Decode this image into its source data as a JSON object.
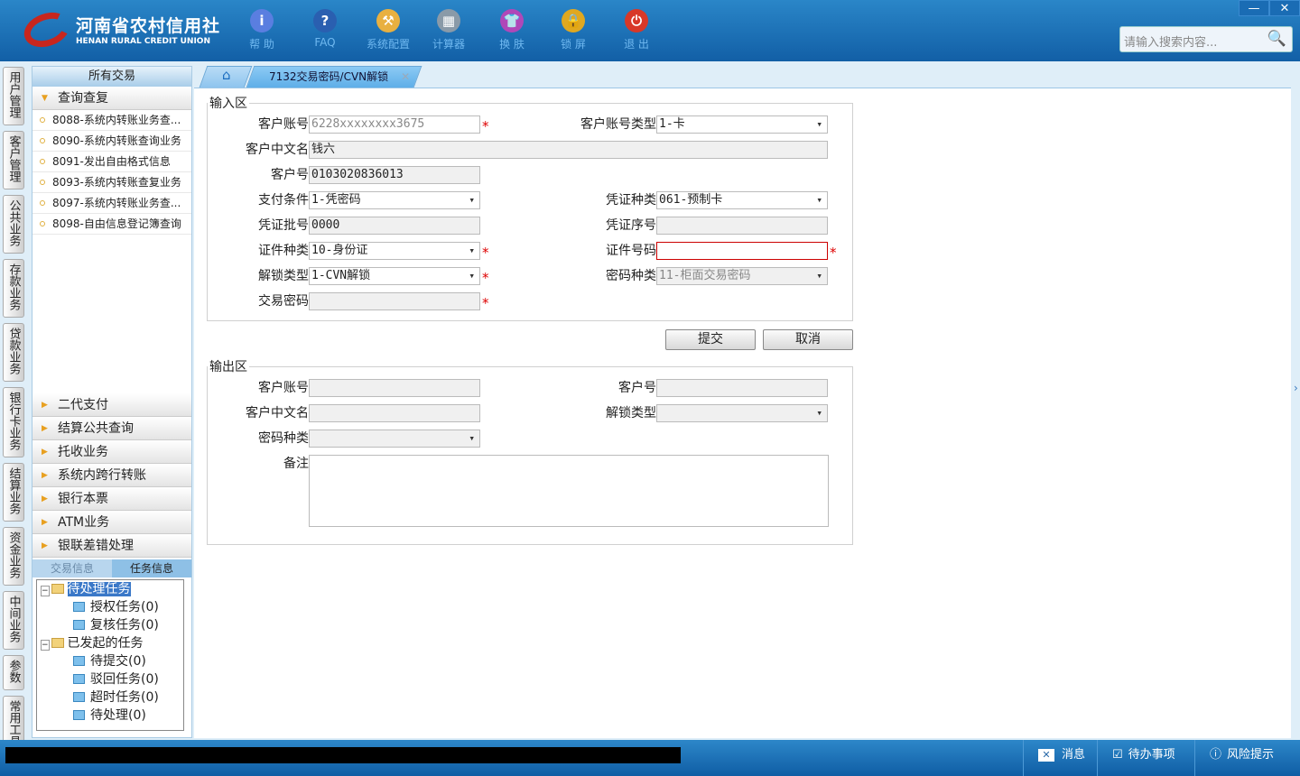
{
  "header": {
    "logo_cn": "河南省农村信用社",
    "logo_en": "HENAN RURAL CREDIT UNION",
    "tools": [
      {
        "label": "帮 助",
        "icon": "info-icon",
        "color": "#5a7ee0",
        "glyph": "i"
      },
      {
        "label": "FAQ",
        "icon": "help-icon",
        "color": "#2a5fb0",
        "glyph": "?"
      },
      {
        "label": "系统配置",
        "icon": "toolbox-icon",
        "color": "#e8b040",
        "glyph": "⚒"
      },
      {
        "label": "计算器",
        "icon": "calculator-icon",
        "color": "#8a9aa8",
        "glyph": "▦"
      },
      {
        "label": "换 肤",
        "icon": "shirt-icon",
        "color": "#b048b8",
        "glyph": "👕"
      },
      {
        "label": "锁 屏",
        "icon": "lock-icon",
        "color": "#e0a820",
        "glyph": "🔒"
      },
      {
        "label": "退 出",
        "icon": "power-icon",
        "color": "#d83828",
        "glyph": "⏻"
      }
    ],
    "minimize": "—",
    "close": "✕",
    "search_placeholder": "请输入搜索内容..."
  },
  "vtabs": [
    "用户管理",
    "客户管理",
    "公共业务",
    "存款业务",
    "贷款业务",
    "银行卡业务",
    "结算业务",
    "资金业务",
    "中间业务",
    "参数",
    "常用工具"
  ],
  "sidebar": {
    "title": "所有交易",
    "open_group": "查询查复",
    "items": [
      "8088-系统内转账业务查...",
      "8090-系统内转账查询业务",
      "8091-发出自由格式信息",
      "8093-系统内转账查复业务",
      "8097-系统内转账业务查...",
      "8098-自由信息登记簿查询"
    ],
    "groups": [
      "二代支付",
      "结算公共查询",
      "托收业务",
      "系统内跨行转账",
      "银行本票",
      "ATM业务",
      "银联差错处理"
    ],
    "tabs": [
      "交易信息",
      "任务信息"
    ],
    "tree": [
      {
        "label": "待处理任务",
        "children": [
          "授权任务(0)",
          "复核任务(0)"
        ]
      },
      {
        "label": "已发起的任务",
        "children": [
          "待提交(0)",
          "驳回任务(0)",
          "超时任务(0)",
          "待处理(0)"
        ]
      }
    ]
  },
  "main": {
    "tab_title": "7132交易密码/CVN解锁",
    "input": {
      "legend": "输入区",
      "account_label": "客户账号",
      "account_value": "6228xxxxxxxx3675",
      "account_type_label": "客户账号类型",
      "account_type": "1-卡",
      "name_label": "客户中文名",
      "name": "钱六",
      "cust_no_label": "客户号",
      "cust_no": "0103020836013",
      "pay_cond_label": "支付条件",
      "pay_cond": "1-凭密码",
      "voucher_type_label": "凭证种类",
      "voucher_type": "061-预制卡",
      "batch_label": "凭证批号",
      "batch": "0000",
      "serial_label": "凭证序号",
      "serial": "",
      "id_type_label": "证件种类",
      "id_type": "10-身份证",
      "id_no_label": "证件号码",
      "id_no": "",
      "unlock_type_label": "解锁类型",
      "unlock_type": "1-CVN解锁",
      "pwd_type_label": "密码种类",
      "pwd_type": "11-柜面交易密码",
      "txn_pwd_label": "交易密码",
      "required": "*"
    },
    "submit": "提交",
    "cancel": "取消",
    "output": {
      "legend": "输出区",
      "account_label": "客户账号",
      "cust_no_label": "客户号",
      "name_label": "客户中文名",
      "unlock_type_label": "解锁类型",
      "pwd_type_label": "密码种类",
      "remark_label": "备注"
    }
  },
  "status": {
    "message": "消息",
    "todo": "待办事项",
    "risk": "风险提示"
  }
}
